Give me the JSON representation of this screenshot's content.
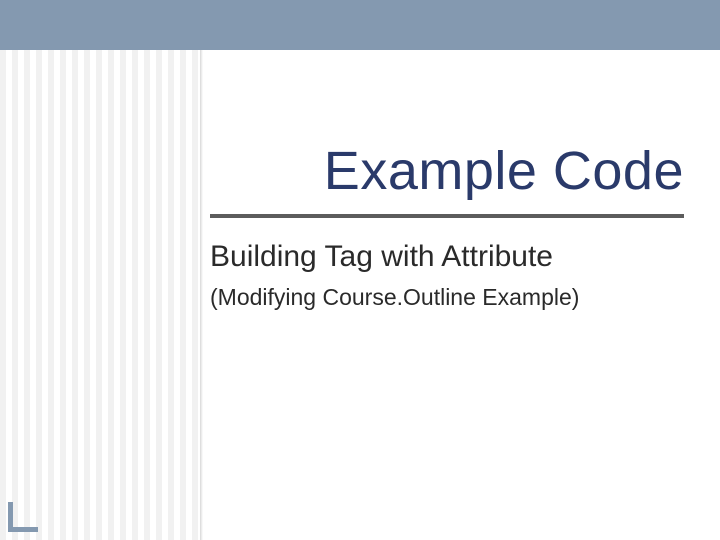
{
  "slide": {
    "title": "Example Code",
    "subtitle": "Building Tag with Attribute",
    "description": "(Modifying Course.Outline Example)"
  },
  "colors": {
    "accent": "#8499b0",
    "title_text": "#2a3a6a",
    "divider": "#5c5c5c",
    "stripe_light": "#f1f1f1"
  }
}
